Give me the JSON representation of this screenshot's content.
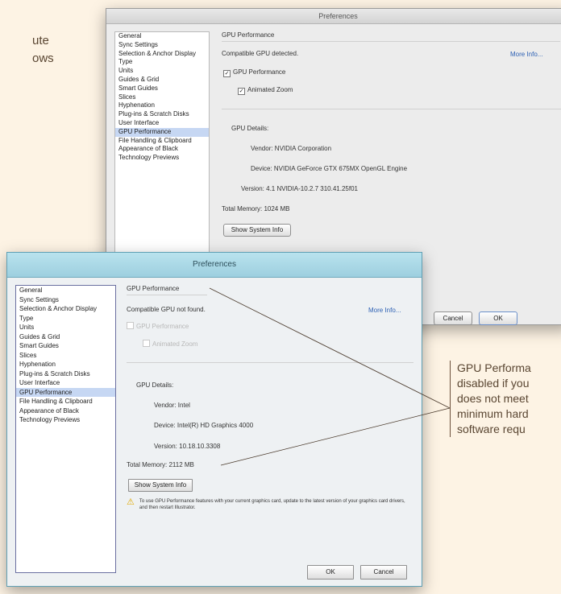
{
  "page": {
    "bg_text": [
      "ute",
      "ows"
    ]
  },
  "mac_dialog": {
    "title": "Preferences",
    "sidebar": [
      "General",
      "Sync Settings",
      "Selection & Anchor Display",
      "Type",
      "Units",
      "Guides & Grid",
      "Smart Guides",
      "Slices",
      "Hyphenation",
      "Plug-ins & Scratch Disks",
      "User Interface",
      "GPU Performance",
      "File Handling & Clipboard",
      "Appearance of Black",
      "Technology Previews"
    ],
    "selected_index": 11,
    "section_title": "GPU Performance",
    "status": "Compatible GPU detected.",
    "more_info": "More Info...",
    "gpu_checkbox": "GPU Performance",
    "zoom_checkbox": "Animated Zoom",
    "details_label": "GPU Details:",
    "vendor": "Vendor: NVIDIA Corporation",
    "device": "Device: NVIDIA GeForce GTX 675MX OpenGL Engine",
    "version": "Version: 4.1 NVIDIA-10.2.7 310.41.25f01",
    "total_memory": "Total Memory: 1024 MB",
    "show_info": "Show System Info",
    "cancel": "Cancel",
    "ok": "OK"
  },
  "win_dialog": {
    "title": "Preferences",
    "sidebar": [
      "General",
      "Sync Settings",
      "Selection & Anchor Display",
      "Type",
      "Units",
      "Guides & Grid",
      "Smart Guides",
      "Slices",
      "Hyphenation",
      "Plug-ins & Scratch Disks",
      "User Interface",
      "GPU Performance",
      "File Handling & Clipboard",
      "Appearance of Black",
      "Technology Previews"
    ],
    "selected_index": 11,
    "section_title": "GPU Performance",
    "status": "Compatible GPU not found.",
    "more_info": "More Info...",
    "gpu_checkbox": "GPU Performance",
    "zoom_checkbox": "Animated Zoom",
    "details_label": "GPU Details:",
    "vendor": "Vendor: Intel",
    "device": "Device: Intel(R) HD Graphics 4000",
    "version": "Version: 10.18.10.3308",
    "total_memory": "Total Memory: 2112 MB",
    "show_info": "Show System Info",
    "warning": "To use GPU Performance features with your current graphics card, update to the latest version of your graphics card drivers, and then restart Illustrator.",
    "ok": "OK",
    "cancel": "Cancel"
  },
  "callout": {
    "lines": [
      "GPU Performa",
      "disabled if you",
      "does not meet",
      "minimum hard",
      "software requ"
    ]
  }
}
